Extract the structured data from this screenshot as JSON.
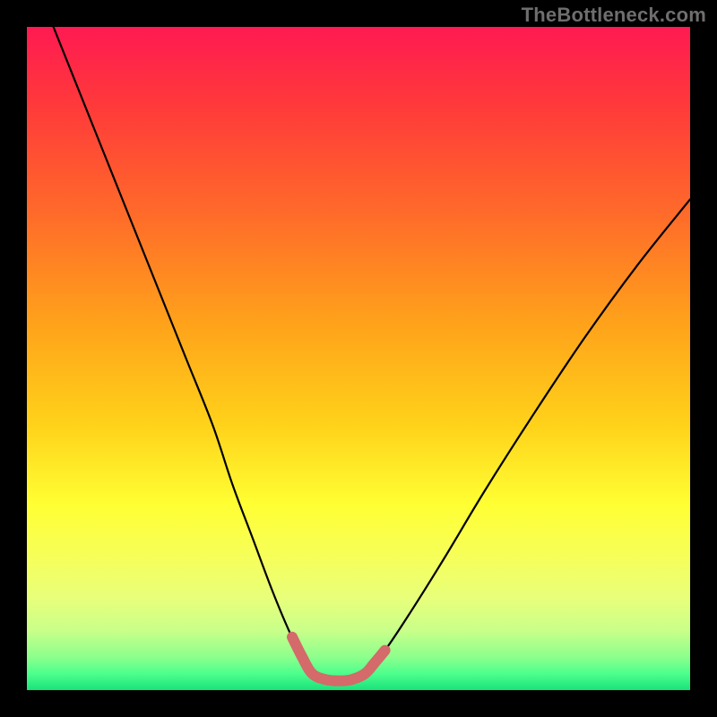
{
  "watermark": "TheBottleneck.com",
  "colors": {
    "frame": "#000000",
    "watermark_text": "#6e6e6e",
    "curve": "#000000",
    "highlight": "#d46a6a",
    "gradient_stops": [
      {
        "offset": 0.0,
        "color": "#ff1a52"
      },
      {
        "offset": 0.12,
        "color": "#ff3a3a"
      },
      {
        "offset": 0.28,
        "color": "#ff6a2a"
      },
      {
        "offset": 0.45,
        "color": "#ffa31a"
      },
      {
        "offset": 0.6,
        "color": "#ffd21a"
      },
      {
        "offset": 0.72,
        "color": "#ffff33"
      },
      {
        "offset": 0.8,
        "color": "#f6ff5a"
      },
      {
        "offset": 0.86,
        "color": "#e9ff7a"
      },
      {
        "offset": 0.91,
        "color": "#c9ff8a"
      },
      {
        "offset": 0.95,
        "color": "#8dff8d"
      },
      {
        "offset": 0.975,
        "color": "#4dff8d"
      },
      {
        "offset": 1.0,
        "color": "#19e27a"
      }
    ]
  },
  "chart_data": {
    "type": "line",
    "title": "",
    "xlabel": "",
    "ylabel": "",
    "xlim": [
      0,
      100
    ],
    "ylim": [
      0,
      100
    ],
    "series": [
      {
        "name": "bottleneck-curve-left",
        "x": [
          4,
          8,
          12,
          16,
          20,
          24,
          28,
          31,
          34,
          37,
          39.5,
          41.5,
          43
        ],
        "y": [
          100,
          90,
          80,
          70,
          60,
          50,
          40,
          31,
          23,
          15,
          9,
          5,
          2.5
        ]
      },
      {
        "name": "bottleneck-curve-bottom",
        "x": [
          43,
          45,
          47,
          49,
          51
        ],
        "y": [
          2.5,
          1.6,
          1.4,
          1.6,
          2.5
        ]
      },
      {
        "name": "bottleneck-curve-right",
        "x": [
          51,
          54,
          58,
          63,
          69,
          76,
          84,
          92,
          100
        ],
        "y": [
          2.5,
          6,
          12,
          20,
          30,
          41,
          53,
          64,
          74
        ]
      },
      {
        "name": "highlight-segment",
        "x": [
          40,
          41.5,
          43,
          45,
          47,
          49,
          51,
          52.5,
          54
        ],
        "y": [
          8,
          5,
          2.5,
          1.6,
          1.4,
          1.6,
          2.5,
          4.2,
          6
        ]
      }
    ],
    "annotations": []
  }
}
